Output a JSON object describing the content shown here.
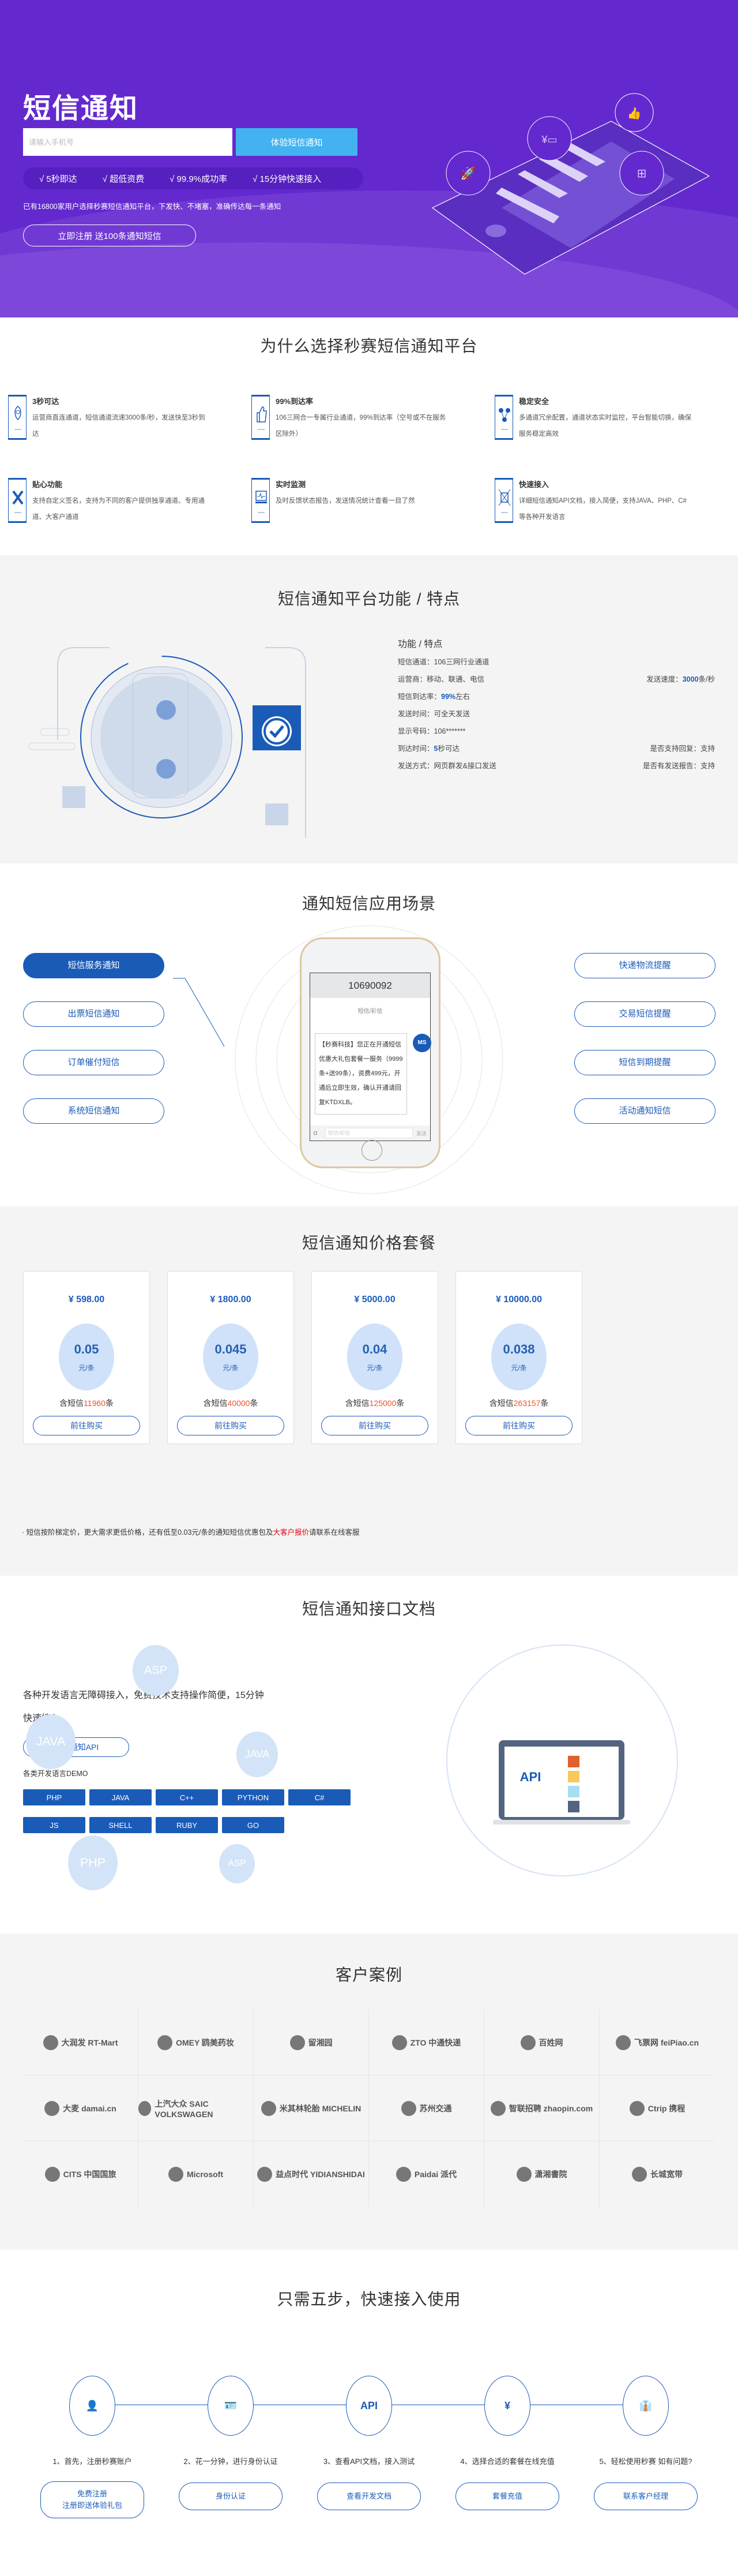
{
  "hero": {
    "title": "短信通知",
    "phone_placeholder": "请输入手机号",
    "try_button": "体验短信通知",
    "features": [
      "√ 5秒即达",
      "√ 超低资费",
      "√ 99.9%成功率",
      "√ 15分钟快速接入"
    ],
    "slogan": "已有16800家用户选择秒赛短信通知平台，下发快、不堵塞，准确传达每一条通知",
    "register_button": "立即注册 送100条通知短信",
    "colors": {
      "background": "#6329cf",
      "try_button": "#42b3f0"
    }
  },
  "why": {
    "title": "为什么选择秒赛短信通知平台",
    "items": [
      {
        "icon": "rocket-icon",
        "title": "3秒可达",
        "desc": "运营商直连通道，短信通道流速3000条/秒，发送快至3秒到达"
      },
      {
        "icon": "thumbs-up-icon",
        "title": "99%到达率",
        "desc": "106三网合一专属行业通道，99%到达率（空号或不在服务区除外）"
      },
      {
        "icon": "shield-network-icon",
        "title": "稳定安全",
        "desc": "多通道冗余配置，通道状态实时监控，平台智能切换，确保服务稳定高效"
      },
      {
        "icon": "tools-icon",
        "title": "贴心功能",
        "desc": "支持自定义签名，支持为不同的客户提供独享通道、专用通道、大客户通道"
      },
      {
        "icon": "monitor-icon",
        "title": "实时监测",
        "desc": "及时反馈状态报告，发送情况统计查看一目了然"
      },
      {
        "icon": "connect-icon",
        "title": "快速接入",
        "desc": "详细短信通知API文档，接入简便，支持JAVA、PHP、C#等各种开发语言"
      }
    ]
  },
  "features": {
    "title": "短信通知平台功能 / 特点",
    "subtitle": "功能 / 特点",
    "rows": [
      {
        "left_label": "短信通道：",
        "left_value": "106三网行业通道",
        "left_hl": "",
        "right_label": "",
        "right_hl": "",
        "right_value": ""
      },
      {
        "left_label": "运营商：",
        "left_value": "移动、联通、电信",
        "left_hl": "",
        "right_label": "发送速度：",
        "right_hl": "3000",
        "right_value": "条/秒"
      },
      {
        "left_label": "短信到达率：",
        "left_hl": "99%",
        "left_value": "左右",
        "right_label": "",
        "right_hl": "",
        "right_value": ""
      },
      {
        "left_label": "发送时间：",
        "left_value": "可全天发送",
        "left_hl": "",
        "right_label": "",
        "right_hl": "",
        "right_value": ""
      },
      {
        "left_label": "显示号码：",
        "left_value": "106*******",
        "left_hl": "",
        "right_label": "",
        "right_hl": "",
        "right_value": ""
      },
      {
        "left_label": "到达时间：",
        "left_hl": "5",
        "left_value": "秒可达",
        "right_label": "是否支持回复：",
        "right_hl": "",
        "right_value": "支持"
      },
      {
        "left_label": "发送方式：",
        "left_value": "网页群发&接口发送",
        "left_hl": "",
        "right_label": "是否有发送报告：",
        "right_hl": "",
        "right_value": "支持"
      }
    ]
  },
  "scenarios": {
    "title": "通知短信应用场景",
    "left": [
      "短信服务通知",
      "出票短信通知",
      "订单催付短信",
      "系统短信通知"
    ],
    "right": [
      "快递物流提醒",
      "交易短信提醒",
      "短信到期提醒",
      "活动通知短信"
    ],
    "active": "短信服务通知",
    "phone": {
      "sender": "10690092",
      "type": "短信/彩信",
      "message": "【秒赛科技】您正在开通短信优惠大礼包套餐一服务（9999条+送99条），资费499元，开通后立即生效，确认开通请回复KTDXLB。",
      "avatar": "MS",
      "input_placeholder": "短信/彩信",
      "send": "发送"
    }
  },
  "pricing": {
    "title": "短信通知价格套餐",
    "plans": [
      {
        "amount": "¥ 598.00",
        "unit_price": "0.05",
        "unit": "元/条",
        "count_prefix": "含短信",
        "count": "11960",
        "count_suffix": "条",
        "button": "前往购买"
      },
      {
        "amount": "¥ 1800.00",
        "unit_price": "0.045",
        "unit": "元/条",
        "count_prefix": "含短信",
        "count": "40000",
        "count_suffix": "条",
        "button": "前往购买"
      },
      {
        "amount": "¥ 5000.00",
        "unit_price": "0.04",
        "unit": "元/条",
        "count_prefix": "含短信",
        "count": "125000",
        "count_suffix": "条",
        "button": "前往购买"
      },
      {
        "amount": "¥ 10000.00",
        "unit_price": "0.038",
        "unit": "元/条",
        "count_prefix": "含短信",
        "count": "263157",
        "count_suffix": "条",
        "button": "前往购买"
      }
    ],
    "note_prefix": "· 短信按阶梯定价，更大需求更低价格，还有低至0.03元/条的通知短信优惠包及",
    "note_link": "大客户报价",
    "note_suffix": "请联系在线客服"
  },
  "api": {
    "title": "短信通知接口文档",
    "description": "各种开发语言无障碍接入，免费技术支持操作简便，15分钟快速接入",
    "api_button": "短信通知API",
    "demo_label": "各类开发语言DEMO",
    "languages": [
      "PHP",
      "JAVA",
      "C++",
      "PYTHON",
      "C#",
      "JS",
      "SHELL",
      "RUBY",
      "GO"
    ],
    "orbit_labels": [
      "ASP",
      "JAVA",
      "JAVA",
      "PHP",
      "ASP"
    ],
    "laptop_label": "API"
  },
  "clients": {
    "title": "客户案例",
    "logos": [
      "大润发 RT-Mart",
      "OMEY 鸥美药妆",
      "留湘园",
      "ZTO 中通快递",
      "百姓网",
      "飞票网 feiPiao.cn",
      "大麦 damai.cn",
      "上汽大众 SAIC VOLKSWAGEN",
      "米其林轮胎 MICHELIN",
      "苏州交通",
      "智联招聘 zhaopin.com",
      "Ctrip 携程",
      "CITS 中国国旅",
      "Microsoft",
      "益点时代 YIDIANSHIDAI",
      "Paidai 派代",
      "潇湘書院",
      "长城宽带"
    ]
  },
  "steps": {
    "title": "只需五步，快速接入使用",
    "items": [
      {
        "icon": "user-edit-icon",
        "label": "1、首先，注册秒赛账户",
        "button": [
          "免费注册",
          "注册即送体验礼包"
        ]
      },
      {
        "icon": "id-card-icon",
        "label": "2、花一分钟，进行身份认证",
        "button": [
          "身份认证"
        ]
      },
      {
        "icon": "api-cloud-icon",
        "label": "3、查看API文档，接入测试",
        "button": [
          "查看开发文档"
        ]
      },
      {
        "icon": "phone-yuan-icon",
        "label": "4、选择合适的套餐在线充值",
        "button": [
          "套餐充值"
        ]
      },
      {
        "icon": "manager-icon",
        "label": "5、轻松使用秒赛 如有问题?",
        "button": [
          "联系客户经理"
        ]
      }
    ]
  },
  "colors": {
    "primary": "#1a5bb8",
    "highlight": "#f0522b",
    "link_red": "#e4000f",
    "light_bg": "#f4f4f4"
  }
}
